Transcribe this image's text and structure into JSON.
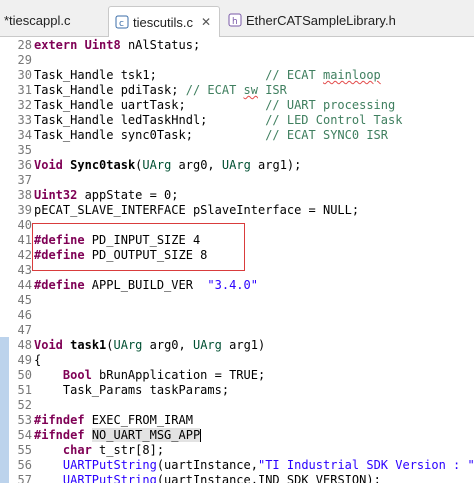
{
  "tabs": [
    {
      "label": "*tiescappl.c",
      "active": false
    },
    {
      "label": "tiescutils.c",
      "active": true,
      "close": "✕"
    },
    {
      "label": "EtherCATSampleLibrary.h",
      "active": false
    }
  ],
  "lines": [
    {
      "n": "28",
      "code": "extern Uint8 nAlStatus;"
    },
    {
      "n": "29",
      "code": ""
    },
    {
      "n": "30",
      "code": "Task_Handle tsk1;               // ECAT mainloop"
    },
    {
      "n": "31",
      "code": "Task_Handle pdiTask; // ECAT sw ISR"
    },
    {
      "n": "32",
      "code": "Task_Handle uartTask;           // UART processing"
    },
    {
      "n": "33",
      "code": "Task_Handle ledTaskHndl;        // LED Control Task"
    },
    {
      "n": "34",
      "code": "Task_Handle sync0Task;          // ECAT SYNC0 ISR"
    },
    {
      "n": "35",
      "code": ""
    },
    {
      "n": "36",
      "code": "Void Sync0task(UArg arg0, UArg arg1);"
    },
    {
      "n": "37",
      "code": ""
    },
    {
      "n": "38",
      "code": "Uint32 appState = 0;"
    },
    {
      "n": "39",
      "code": "pECAT_SLAVE_INTERFACE pSlaveInterface = NULL;"
    },
    {
      "n": "40",
      "code": ""
    },
    {
      "n": "41",
      "code": "#define PD_INPUT_SIZE 4"
    },
    {
      "n": "42",
      "code": "#define PD_OUTPUT_SIZE 8"
    },
    {
      "n": "43",
      "code": ""
    },
    {
      "n": "44",
      "code": "#define APPL_BUILD_VER  \"3.4.0\""
    },
    {
      "n": "45",
      "code": ""
    },
    {
      "n": "46",
      "code": ""
    },
    {
      "n": "47",
      "code": ""
    },
    {
      "n": "48",
      "code": "Void task1(UArg arg0, UArg arg1)"
    },
    {
      "n": "49",
      "code": "{"
    },
    {
      "n": "50",
      "code": "    Bool bRunApplication = TRUE;"
    },
    {
      "n": "51",
      "code": "    Task_Params taskParams;"
    },
    {
      "n": "52",
      "code": ""
    },
    {
      "n": "53",
      "code": "#ifndef EXEC_FROM_IRAM"
    },
    {
      "n": "54",
      "code": "#ifndef NO_UART_MSG_APP"
    },
    {
      "n": "55",
      "code": "    char t_str[8];"
    },
    {
      "n": "56",
      "code": "    UARTPutString(uartInstance,\"TI Industrial SDK Version : \");"
    },
    {
      "n": "57",
      "code": "    UARTPutString(uartInstance,IND_SDK_VERSION);"
    }
  ],
  "colors": {
    "keyword": "#7f0055",
    "comment": "#3f7f5f",
    "string": "#2a00ff",
    "highlight_box": "#d93c3c"
  },
  "icons": {
    "tab0": "c-file-icon",
    "tab1": "c-file-icon",
    "tab2": "h-file-icon"
  }
}
